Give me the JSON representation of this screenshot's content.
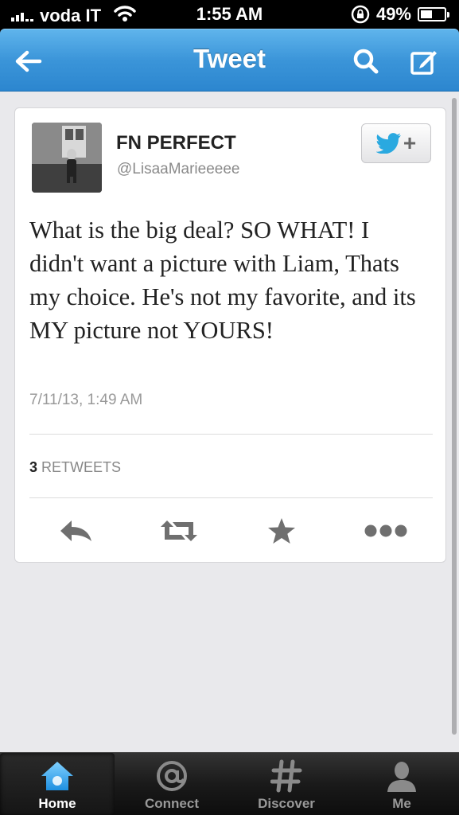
{
  "status_bar": {
    "carrier": "voda IT",
    "time": "1:55 AM",
    "battery": "49%",
    "battery_level": 0.49
  },
  "navbar": {
    "title": "Tweet",
    "back_icon": "back-arrow-icon",
    "search_icon": "search-icon",
    "compose_icon": "compose-icon"
  },
  "tweet": {
    "user_name": "FN PERFECT",
    "handle": "@LisaaMarieeeee",
    "text": "What is the big deal? SO WHAT! I didn't want a picture with Liam, Thats my choice. He's not my favorite, and its MY picture not YOURS!",
    "timestamp": "7/11/13, 1:49 AM",
    "retweet_count": "3",
    "retweet_label": "RETWEETS",
    "follow_icon": "twitter-bird-follow-icon"
  },
  "actions": [
    "reply-icon",
    "retweet-icon",
    "favorite-star-icon",
    "more-icon"
  ],
  "tabbar": {
    "tabs": [
      {
        "label": "Home",
        "icon": "home-icon"
      },
      {
        "label": "Connect",
        "icon": "at-icon"
      },
      {
        "label": "Discover",
        "icon": "hash-icon"
      },
      {
        "label": "Me",
        "icon": "person-icon"
      }
    ],
    "active": "Home"
  },
  "colors": {
    "navbar_blue": "#3b95d9",
    "twitter_blue": "#2aa9e0",
    "background": "#e9e9ec"
  }
}
